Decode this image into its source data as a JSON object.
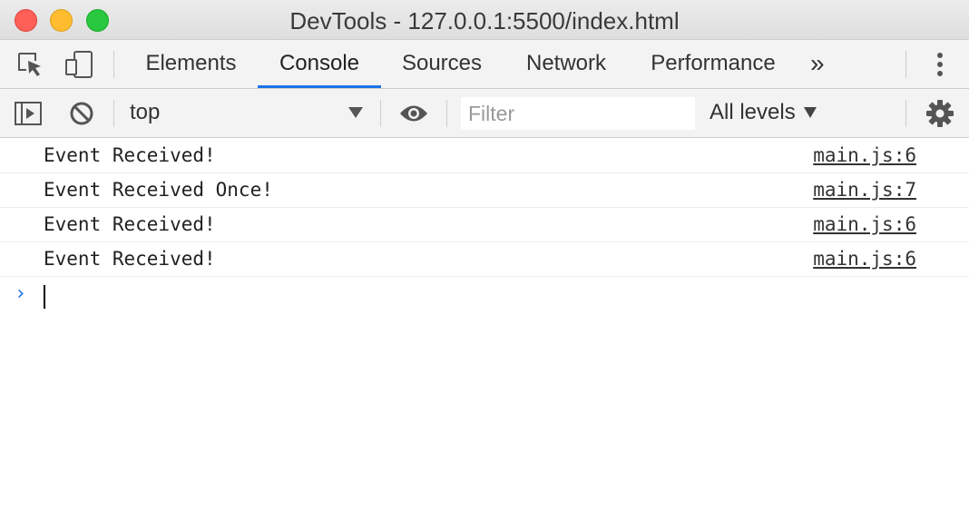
{
  "window": {
    "title": "DevTools - 127.0.0.1:5500/index.html"
  },
  "tabs": [
    {
      "label": "Elements",
      "active": false
    },
    {
      "label": "Console",
      "active": true
    },
    {
      "label": "Sources",
      "active": false
    },
    {
      "label": "Network",
      "active": false
    },
    {
      "label": "Performance",
      "active": false
    }
  ],
  "tab_overflow_label": "»",
  "toolbar": {
    "context": "top",
    "filter_placeholder": "Filter",
    "levels": "All levels"
  },
  "console": {
    "messages": [
      {
        "text": "Event Received!",
        "source": "main.js:6"
      },
      {
        "text": "Event Received Once!",
        "source": "main.js:7"
      },
      {
        "text": "Event Received!",
        "source": "main.js:6"
      },
      {
        "text": "Event Received!",
        "source": "main.js:6"
      }
    ],
    "prompt_symbol": "›"
  },
  "colors": {
    "accent": "#1a73e8",
    "toolbar_bg": "#f3f3f3"
  }
}
